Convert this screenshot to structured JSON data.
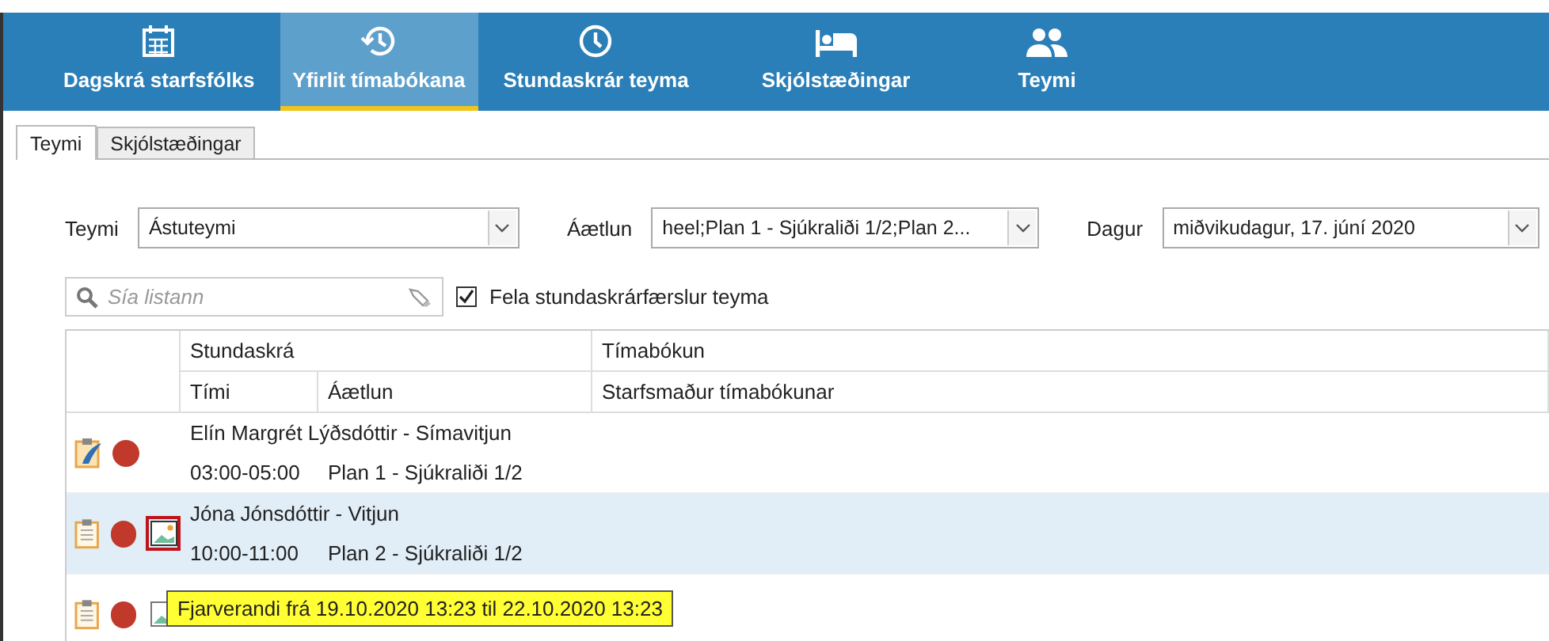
{
  "nav": [
    {
      "label": "Dagskrá starfsfólks",
      "kind": "calendar",
      "selected": false
    },
    {
      "label": "Yfirlit tímabókana",
      "kind": "history",
      "selected": true
    },
    {
      "label": "Stundaskrár teyma",
      "kind": "clock",
      "selected": false
    },
    {
      "label": "Skjólstæðingar",
      "kind": "bed",
      "selected": false
    },
    {
      "label": "Teymi",
      "kind": "people",
      "selected": false
    }
  ],
  "subtabs": [
    {
      "label": "Teymi",
      "selected": true
    },
    {
      "label": "Skjólstæðingar",
      "selected": false
    }
  ],
  "filters": [
    {
      "label": "Teymi",
      "value": "Ástuteymi"
    },
    {
      "label": "Áætlun",
      "value": "heel;Plan 1 - Sjúkraliði 1/2;Plan 2..."
    },
    {
      "label": "Dagur",
      "value": "miðvikudagur, 17. júní 2020"
    }
  ],
  "search": {
    "placeholder": "Sía listann"
  },
  "hide_team_entries": {
    "label": "Fela stundaskrárfærslur teyma",
    "checked": true
  },
  "table": {
    "group_headers": [
      "Stundaskrá",
      "Tímabókun"
    ],
    "columns": [
      "Tími",
      "Áætlun",
      "Starfsmaður tímabókunar"
    ],
    "rows": [
      {
        "kind": "signed",
        "color": "#c0392b",
        "picture": false,
        "selected": false,
        "title": "Elín Margrét Lýðsdóttir - Símavitjun",
        "time": "03:00-05:00",
        "plan": "Plan 1 - Sjúkraliði 1/2"
      },
      {
        "kind": "plain",
        "color": "#c0392b",
        "picture": true,
        "highlighted": true,
        "selected": true,
        "title": "Jóna Jónsdóttir - Vitjun",
        "time": "10:00-11:00",
        "plan": "Plan 2 - Sjúkraliði 1/2"
      },
      {
        "kind": "plain",
        "color": "#c0392b",
        "picture": true,
        "highlighted": false,
        "selected": false
      }
    ]
  },
  "tooltip": {
    "text": "Fjarverandi frá 19.10.2020 13:23 til 22.10.2020 13:23"
  }
}
